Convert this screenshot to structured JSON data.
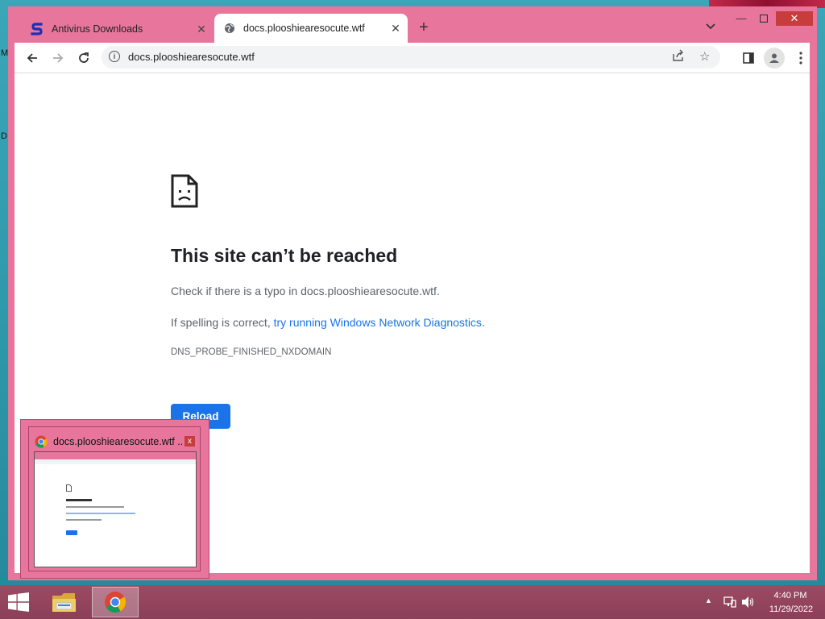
{
  "desktop": {
    "side_letters": [
      "M",
      "D"
    ]
  },
  "browser": {
    "tabs": [
      {
        "title": "Antivirus Downloads",
        "favicon": "s-logo-icon",
        "active": false
      },
      {
        "title": "docs.plooshiearesocute.wtf",
        "favicon": "globe-icon",
        "active": true
      }
    ],
    "address": "docs.plooshiearesocute.wtf",
    "accent": "#e8769c"
  },
  "error_page": {
    "title": "This site can’t be reached",
    "line1": "Check if there is a typo in docs.plooshiearesocute.wtf.",
    "line2_prefix": "If spelling is correct, ",
    "line2_link": "try running Windows Network Diagnostics",
    "line2_suffix": ".",
    "code": "DNS_PROBE_FINISHED_NXDOMAIN",
    "reload_label": "Reload"
  },
  "thumbnail": {
    "title": "docs.plooshiearesocute.wtf ...",
    "close_label": "x"
  },
  "taskbar": {
    "time": "4:40 PM",
    "date": "11/29/2022"
  }
}
